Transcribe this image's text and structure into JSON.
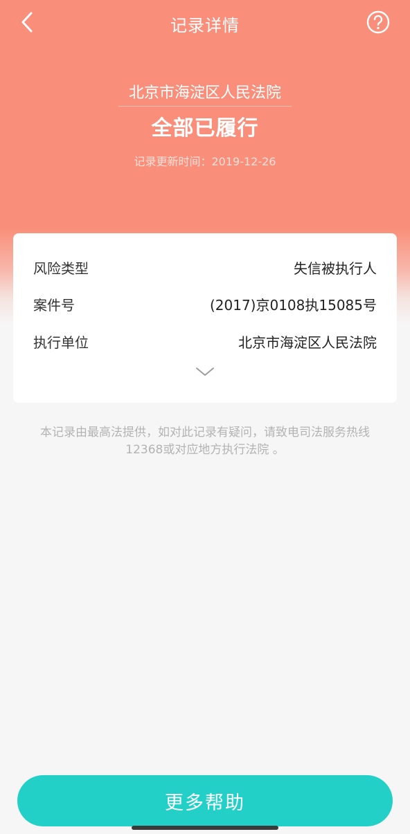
{
  "nav": {
    "title": "记录详情",
    "back_icon": "chevron-left-icon",
    "help_icon": "question-circle-icon"
  },
  "record": {
    "court": "北京市海淀区人民法院",
    "status": "全部已履行",
    "update_time": "记录更新时间：2019-12-26"
  },
  "details": {
    "rows": [
      {
        "label": "风险类型",
        "value": "失信被执行人"
      },
      {
        "label": "案件号",
        "value": "(2017)京0108执15085号"
      },
      {
        "label": "执行单位",
        "value": "北京市海淀区人民法院"
      }
    ],
    "expand_icon": "chevron-down-icon"
  },
  "notice": "本记录由最高法提供，如对此记录有疑问，请致电司法服务热线12368或对应地方执行法院 。",
  "actions": {
    "more_help": "更多帮助"
  },
  "colors": {
    "header": "#f98f7a",
    "accent_button": "#22d0c8",
    "background": "#f6f6f6"
  }
}
